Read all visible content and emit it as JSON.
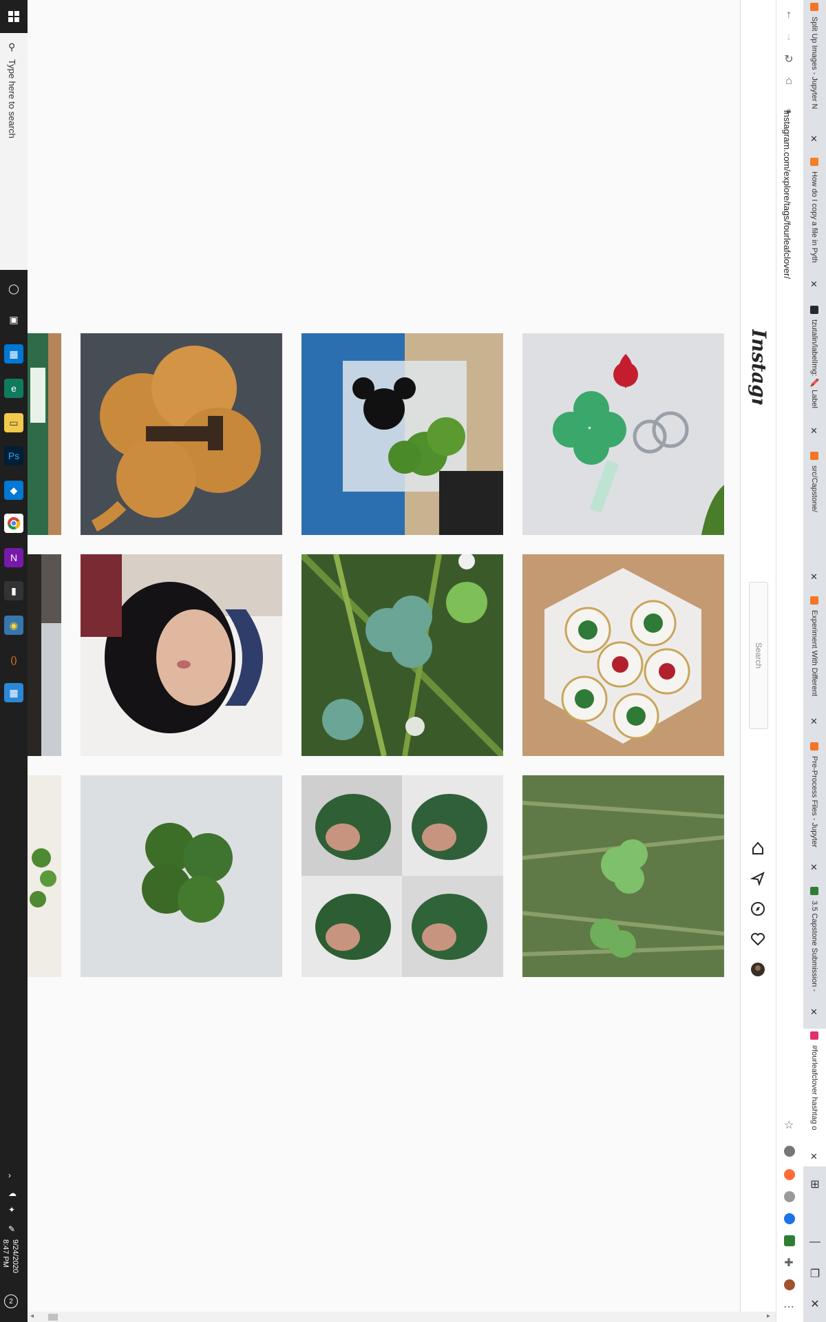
{
  "taskbar": {
    "search_placeholder": "Type here to search",
    "time": "8:47 PM",
    "date": "9/24/2020",
    "notification_count": "2"
  },
  "browser": {
    "url": "instagram.com/explore/tags/fourleafclover/",
    "tabs": [
      {
        "label": "Split Up Images - Jupyter N",
        "color": "#f37626"
      },
      {
        "label": "How do I copy a file in Pyth",
        "color": "#f48024"
      },
      {
        "label": "tzutalin/labelImg: 🖍️ Label",
        "color": "#24292e"
      },
      {
        "label": "src/Capstone/",
        "color": "#f37626"
      },
      {
        "label": "Experiment With Different",
        "color": "#f37626"
      },
      {
        "label": "Pre-Process Files - Jupyter",
        "color": "#f37626"
      },
      {
        "label": "3.5 Capstone Submission -",
        "color": "#2e7d32"
      },
      {
        "label": "#fourleafclover hashtag o",
        "color": "#e1306c"
      }
    ]
  },
  "instagram": {
    "logo": "Instagram",
    "search_placeholder": "Search"
  },
  "posts": [
    {
      "id": "clover-partial-1"
    },
    {
      "id": "wood-clover-1"
    },
    {
      "id": "mickey-box-clover"
    },
    {
      "id": "crochet-keychain"
    },
    {
      "id": "partial-window"
    },
    {
      "id": "woman-selfie"
    },
    {
      "id": "clover-grass-closeup"
    },
    {
      "id": "resin-coaster"
    },
    {
      "id": "partial-clover-plant"
    },
    {
      "id": "single-clover-white"
    },
    {
      "id": "four-faces-collage"
    },
    {
      "id": "clover-in-grass"
    }
  ]
}
